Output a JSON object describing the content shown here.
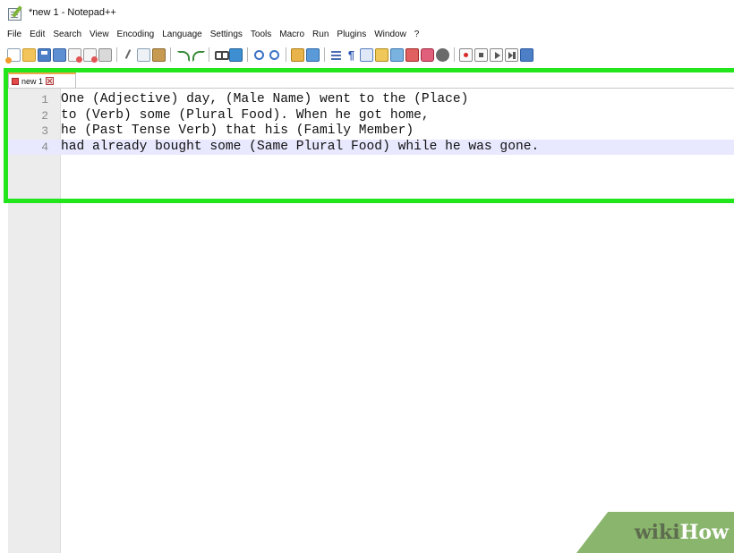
{
  "window": {
    "title": "*new 1 - Notepad++"
  },
  "menu": {
    "items": [
      "File",
      "Edit",
      "Search",
      "View",
      "Encoding",
      "Language",
      "Settings",
      "Tools",
      "Macro",
      "Run",
      "Plugins",
      "Window",
      "?"
    ]
  },
  "toolbar": {
    "icons": [
      "new-file-icon",
      "open-file-icon",
      "save-icon",
      "save-all-icon",
      "close-icon",
      "close-all-icon",
      "print-icon",
      "cut-icon",
      "copy-icon",
      "paste-icon",
      "undo-icon",
      "redo-icon",
      "find-icon",
      "replace-icon",
      "zoom-in-icon",
      "zoom-out-icon",
      "sync-vertical-icon",
      "sync-horizontal-icon",
      "word-wrap-icon",
      "show-all-characters-icon",
      "indent-guide-icon",
      "user-defined-language-icon",
      "document-map-icon",
      "function-list-icon",
      "folder-as-workspace-icon",
      "monitoring-icon",
      "record-macro-icon",
      "stop-recording-icon",
      "playback-icon",
      "run-multiple-macro-icon",
      "save-macro-icon"
    ]
  },
  "tabs": [
    {
      "label": "new 1"
    }
  ],
  "editor": {
    "current_line": 4,
    "lines": [
      {
        "number": "1",
        "text": "One (Adjective) day, (Male Name) went to the (Place)"
      },
      {
        "number": "2",
        "text": "to (Verb) some (Plural Food). When he got home,"
      },
      {
        "number": "3",
        "text": "he (Past Tense Verb) that his (Family Member)"
      },
      {
        "number": "4",
        "text": "had already bought some (Same Plural Food) while he was gone."
      }
    ]
  },
  "colors": {
    "highlight": "#22e51c",
    "gutter": "#ececec",
    "current_line": "#e8e8ff",
    "watermark": "#8ab56c"
  },
  "watermark": {
    "wiki": "wiki",
    "how": "How"
  }
}
